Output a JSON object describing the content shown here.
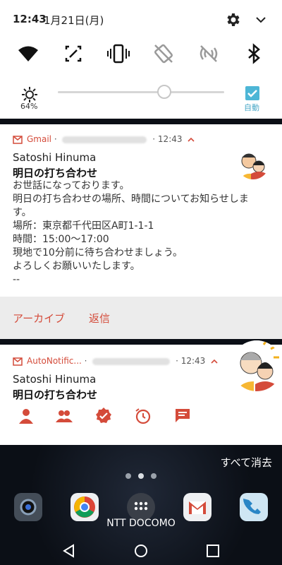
{
  "status": {
    "time": "12:43",
    "date": "1月21日(月)"
  },
  "quick_settings": {
    "tiles": [
      "wifi-icon",
      "screen-capture-icon",
      "vibrate-icon",
      "auto-rotate-off-icon",
      "nfc-off-icon",
      "bluetooth-icon"
    ],
    "brightness_percent_label": "64%",
    "brightness_level": 0.64,
    "auto_label": "自動",
    "accent": "#4db6d6"
  },
  "notification1": {
    "app": "Gmail",
    "time": "12:43",
    "sender": "Satoshi Hinuma",
    "subject": "明日の打ち合わせ",
    "body": "お世話になっております。\n明日の打ち合わせの場所、時間についてお知らせします。\n場所：東京都千代田区A町1-1-1\n時間：15:00〜17:00\n現地で10分前に待ち合わせましょう。\nよろしくお願いいたします。\n--",
    "actions": {
      "archive": "アーカイブ",
      "reply": "返信"
    }
  },
  "notification2": {
    "app": "AutoNotific...",
    "time": "12:43",
    "sender": "Satoshi Hinuma",
    "subject": "明日の打ち合わせ",
    "icons": [
      "person-icon",
      "people-icon",
      "verified-icon",
      "snooze-icon",
      "chat-icon"
    ]
  },
  "home": {
    "clear_all": "すべて消去",
    "carrier": "NTT DOCOMO",
    "dock": [
      "camera-icon",
      "chrome-icon",
      "apps-icon",
      "gmail-icon",
      "phone-icon"
    ]
  },
  "colors": {
    "gmail_red": "#d44b3a"
  }
}
